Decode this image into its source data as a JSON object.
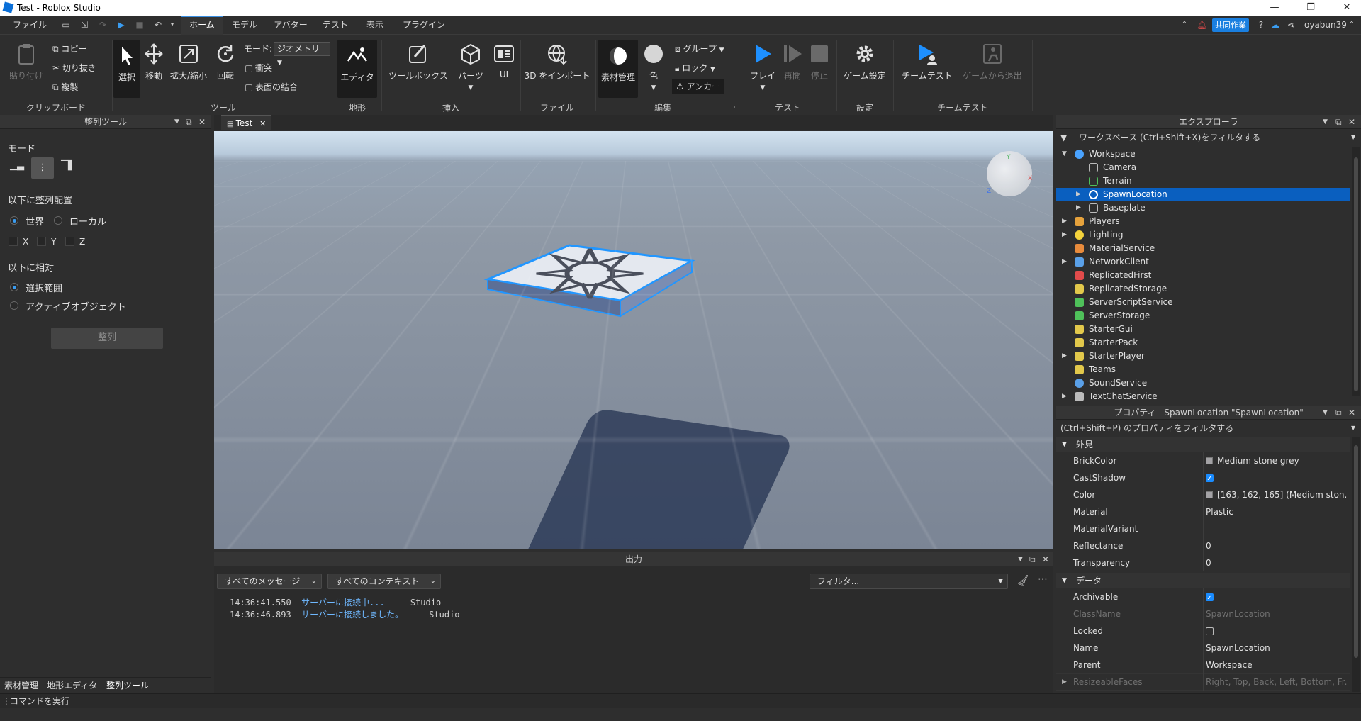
{
  "window": {
    "title": "Test - Roblox Studio",
    "minimize": "—",
    "maximize": "❐",
    "close": "✕"
  },
  "menubar": {
    "file": "ファイル",
    "tabs": [
      "ホーム",
      "モデル",
      "アバター",
      "テスト",
      "表示",
      "プラグイン"
    ],
    "collab": "共同作業",
    "username": "oyabun39"
  },
  "ribbon": {
    "clipboard": {
      "paste": "貼り付け",
      "copy": "コピー",
      "cut": "切り抜き",
      "duplicate": "複製",
      "label": "クリップボード"
    },
    "tools": {
      "select": "選択",
      "move": "移動",
      "scale": "拡大/縮小",
      "rotate": "回転",
      "mode_label": "モード:",
      "mode_value": "ジオメトリ",
      "collisions": "衝突",
      "join_surfaces": "表面の結合",
      "label": "ツール"
    },
    "terrain": {
      "editor": "エディタ",
      "label": "地形"
    },
    "insert": {
      "toolbox": "ツールボックス",
      "part": "パーツ",
      "ui": "UI",
      "label": "挿入"
    },
    "file": {
      "import3d": "3D をインポート",
      "label": "ファイル"
    },
    "edit": {
      "material": "素材管理",
      "color": "色",
      "group": "グループ",
      "lock": "ロック",
      "anchor": "アンカー",
      "label": "編集"
    },
    "test": {
      "play": "プレイ",
      "resume": "再開",
      "stop": "停止",
      "label": "テスト"
    },
    "settings": {
      "game_settings": "ゲーム設定",
      "label": "設定"
    },
    "teamtest": {
      "team_test": "チームテスト",
      "exit_game": "ゲームから退出",
      "label": "チームテスト"
    }
  },
  "align_panel": {
    "title": "整列ツール",
    "mode_label": "モード",
    "align_in_label": "以下に整列配置",
    "world": "世界",
    "local": "ローカル",
    "axis_x": "X",
    "axis_y": "Y",
    "axis_z": "Z",
    "relative_to_label": "以下に相対",
    "selection": "選択範囲",
    "active_object": "アクティブオブジェクト",
    "align_button": "整列",
    "bottom_tabs": [
      "素材管理",
      "地形エディタ",
      "整列ツール"
    ]
  },
  "viewport": {
    "tab_title": "Test"
  },
  "output": {
    "title": "出力",
    "all_messages": "すべてのメッセージ",
    "all_contexts": "すべてのコンテキスト",
    "filter_placeholder": "フィルタ...",
    "logs": [
      {
        "time": "14:36:41.550",
        "msg": "サーバーに接続中...",
        "src": "-  Studio"
      },
      {
        "time": "14:36:46.893",
        "msg": "サーバーに接続しました。",
        "src": "-  Studio"
      }
    ]
  },
  "explorer": {
    "title": "エクスプローラ",
    "filter": "ワークスペース (Ctrl+Shift+X)をフィルタする",
    "items": [
      {
        "name": "Workspace",
        "color": "#4aa3ff"
      },
      {
        "name": "Camera",
        "color": "#bbbbbb"
      },
      {
        "name": "Terrain",
        "color": "#4fc15a"
      },
      {
        "name": "SpawnLocation",
        "color": "#dddddd"
      },
      {
        "name": "Baseplate",
        "color": "#bbbbbb"
      },
      {
        "name": "Players",
        "color": "#e6a23c"
      },
      {
        "name": "Lighting",
        "color": "#f5d33c"
      },
      {
        "name": "MaterialService",
        "color": "#e88b3c"
      },
      {
        "name": "NetworkClient",
        "color": "#5aa0e8"
      },
      {
        "name": "ReplicatedFirst",
        "color": "#e24b4b"
      },
      {
        "name": "ReplicatedStorage",
        "color": "#e2c84b"
      },
      {
        "name": "ServerScriptService",
        "color": "#4fc15a"
      },
      {
        "name": "ServerStorage",
        "color": "#4fc15a"
      },
      {
        "name": "StarterGui",
        "color": "#e2c84b"
      },
      {
        "name": "StarterPack",
        "color": "#e2c84b"
      },
      {
        "name": "StarterPlayer",
        "color": "#e2c84b"
      },
      {
        "name": "Teams",
        "color": "#e2c84b"
      },
      {
        "name": "SoundService",
        "color": "#5aa0e8"
      },
      {
        "name": "TextChatService",
        "color": "#bbbbbb"
      }
    ]
  },
  "properties": {
    "title": "プロパティ - SpawnLocation \"SpawnLocation\"",
    "filter": "(Ctrl+Shift+P) のプロパティをフィルタする",
    "cat_appearance": "外見",
    "cat_data": "データ",
    "brickcolor": {
      "name": "BrickColor",
      "value": "Medium stone grey"
    },
    "castshadow": {
      "name": "CastShadow"
    },
    "color": {
      "name": "Color",
      "value": "[163, 162, 165] (Medium ston..."
    },
    "material": {
      "name": "Material",
      "value": "Plastic"
    },
    "materialvariant": {
      "name": "MaterialVariant",
      "value": ""
    },
    "reflectance": {
      "name": "Reflectance",
      "value": "0"
    },
    "transparency": {
      "name": "Transparency",
      "value": "0"
    },
    "archivable": {
      "name": "Archivable"
    },
    "classname": {
      "name": "ClassName",
      "value": "SpawnLocation"
    },
    "locked": {
      "name": "Locked"
    },
    "pname": {
      "name": "Name",
      "value": "SpawnLocation"
    },
    "parent": {
      "name": "Parent",
      "value": "Workspace"
    },
    "resizeablefaces": {
      "name": "ResizeableFaces",
      "value": "Right, Top, Back, Left, Bottom, Fr..."
    }
  },
  "command_bar": {
    "placeholder": "コマンドを実行"
  }
}
